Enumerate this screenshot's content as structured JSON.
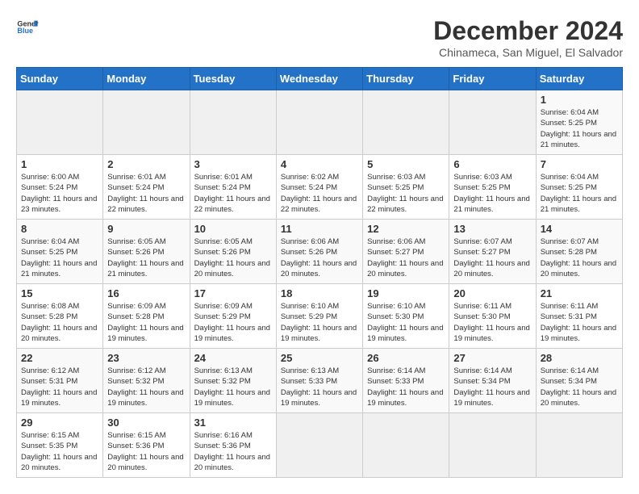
{
  "header": {
    "logo_line1": "General",
    "logo_line2": "Blue",
    "title": "December 2024",
    "subtitle": "Chinameca, San Miguel, El Salvador"
  },
  "calendar": {
    "days_of_week": [
      "Sunday",
      "Monday",
      "Tuesday",
      "Wednesday",
      "Thursday",
      "Friday",
      "Saturday"
    ],
    "weeks": [
      [
        {
          "day": "",
          "empty": true
        },
        {
          "day": "",
          "empty": true
        },
        {
          "day": "",
          "empty": true
        },
        {
          "day": "",
          "empty": true
        },
        {
          "day": "",
          "empty": true
        },
        {
          "day": "",
          "empty": true
        },
        {
          "day": "1",
          "sunrise": "Sunrise: 6:04 AM",
          "sunset": "Sunset: 5:25 PM",
          "daylight": "Daylight: 11 hours and 21 minutes."
        }
      ],
      [
        {
          "day": "1",
          "sunrise": "Sunrise: 6:00 AM",
          "sunset": "Sunset: 5:24 PM",
          "daylight": "Daylight: 11 hours and 23 minutes."
        },
        {
          "day": "2",
          "sunrise": "Sunrise: 6:01 AM",
          "sunset": "Sunset: 5:24 PM",
          "daylight": "Daylight: 11 hours and 22 minutes."
        },
        {
          "day": "3",
          "sunrise": "Sunrise: 6:01 AM",
          "sunset": "Sunset: 5:24 PM",
          "daylight": "Daylight: 11 hours and 22 minutes."
        },
        {
          "day": "4",
          "sunrise": "Sunrise: 6:02 AM",
          "sunset": "Sunset: 5:24 PM",
          "daylight": "Daylight: 11 hours and 22 minutes."
        },
        {
          "day": "5",
          "sunrise": "Sunrise: 6:03 AM",
          "sunset": "Sunset: 5:25 PM",
          "daylight": "Daylight: 11 hours and 22 minutes."
        },
        {
          "day": "6",
          "sunrise": "Sunrise: 6:03 AM",
          "sunset": "Sunset: 5:25 PM",
          "daylight": "Daylight: 11 hours and 21 minutes."
        },
        {
          "day": "7",
          "sunrise": "Sunrise: 6:04 AM",
          "sunset": "Sunset: 5:25 PM",
          "daylight": "Daylight: 11 hours and 21 minutes."
        }
      ],
      [
        {
          "day": "8",
          "sunrise": "Sunrise: 6:04 AM",
          "sunset": "Sunset: 5:25 PM",
          "daylight": "Daylight: 11 hours and 21 minutes."
        },
        {
          "day": "9",
          "sunrise": "Sunrise: 6:05 AM",
          "sunset": "Sunset: 5:26 PM",
          "daylight": "Daylight: 11 hours and 21 minutes."
        },
        {
          "day": "10",
          "sunrise": "Sunrise: 6:05 AM",
          "sunset": "Sunset: 5:26 PM",
          "daylight": "Daylight: 11 hours and 20 minutes."
        },
        {
          "day": "11",
          "sunrise": "Sunrise: 6:06 AM",
          "sunset": "Sunset: 5:26 PM",
          "daylight": "Daylight: 11 hours and 20 minutes."
        },
        {
          "day": "12",
          "sunrise": "Sunrise: 6:06 AM",
          "sunset": "Sunset: 5:27 PM",
          "daylight": "Daylight: 11 hours and 20 minutes."
        },
        {
          "day": "13",
          "sunrise": "Sunrise: 6:07 AM",
          "sunset": "Sunset: 5:27 PM",
          "daylight": "Daylight: 11 hours and 20 minutes."
        },
        {
          "day": "14",
          "sunrise": "Sunrise: 6:07 AM",
          "sunset": "Sunset: 5:28 PM",
          "daylight": "Daylight: 11 hours and 20 minutes."
        }
      ],
      [
        {
          "day": "15",
          "sunrise": "Sunrise: 6:08 AM",
          "sunset": "Sunset: 5:28 PM",
          "daylight": "Daylight: 11 hours and 20 minutes."
        },
        {
          "day": "16",
          "sunrise": "Sunrise: 6:09 AM",
          "sunset": "Sunset: 5:28 PM",
          "daylight": "Daylight: 11 hours and 19 minutes."
        },
        {
          "day": "17",
          "sunrise": "Sunrise: 6:09 AM",
          "sunset": "Sunset: 5:29 PM",
          "daylight": "Daylight: 11 hours and 19 minutes."
        },
        {
          "day": "18",
          "sunrise": "Sunrise: 6:10 AM",
          "sunset": "Sunset: 5:29 PM",
          "daylight": "Daylight: 11 hours and 19 minutes."
        },
        {
          "day": "19",
          "sunrise": "Sunrise: 6:10 AM",
          "sunset": "Sunset: 5:30 PM",
          "daylight": "Daylight: 11 hours and 19 minutes."
        },
        {
          "day": "20",
          "sunrise": "Sunrise: 6:11 AM",
          "sunset": "Sunset: 5:30 PM",
          "daylight": "Daylight: 11 hours and 19 minutes."
        },
        {
          "day": "21",
          "sunrise": "Sunrise: 6:11 AM",
          "sunset": "Sunset: 5:31 PM",
          "daylight": "Daylight: 11 hours and 19 minutes."
        }
      ],
      [
        {
          "day": "22",
          "sunrise": "Sunrise: 6:12 AM",
          "sunset": "Sunset: 5:31 PM",
          "daylight": "Daylight: 11 hours and 19 minutes."
        },
        {
          "day": "23",
          "sunrise": "Sunrise: 6:12 AM",
          "sunset": "Sunset: 5:32 PM",
          "daylight": "Daylight: 11 hours and 19 minutes."
        },
        {
          "day": "24",
          "sunrise": "Sunrise: 6:13 AM",
          "sunset": "Sunset: 5:32 PM",
          "daylight": "Daylight: 11 hours and 19 minutes."
        },
        {
          "day": "25",
          "sunrise": "Sunrise: 6:13 AM",
          "sunset": "Sunset: 5:33 PM",
          "daylight": "Daylight: 11 hours and 19 minutes."
        },
        {
          "day": "26",
          "sunrise": "Sunrise: 6:14 AM",
          "sunset": "Sunset: 5:33 PM",
          "daylight": "Daylight: 11 hours and 19 minutes."
        },
        {
          "day": "27",
          "sunrise": "Sunrise: 6:14 AM",
          "sunset": "Sunset: 5:34 PM",
          "daylight": "Daylight: 11 hours and 19 minutes."
        },
        {
          "day": "28",
          "sunrise": "Sunrise: 6:14 AM",
          "sunset": "Sunset: 5:34 PM",
          "daylight": "Daylight: 11 hours and 20 minutes."
        }
      ],
      [
        {
          "day": "29",
          "sunrise": "Sunrise: 6:15 AM",
          "sunset": "Sunset: 5:35 PM",
          "daylight": "Daylight: 11 hours and 20 minutes."
        },
        {
          "day": "30",
          "sunrise": "Sunrise: 6:15 AM",
          "sunset": "Sunset: 5:36 PM",
          "daylight": "Daylight: 11 hours and 20 minutes."
        },
        {
          "day": "31",
          "sunrise": "Sunrise: 6:16 AM",
          "sunset": "Sunset: 5:36 PM",
          "daylight": "Daylight: 11 hours and 20 minutes."
        },
        {
          "day": "",
          "empty": true
        },
        {
          "day": "",
          "empty": true
        },
        {
          "day": "",
          "empty": true
        },
        {
          "day": "",
          "empty": true
        }
      ]
    ]
  }
}
